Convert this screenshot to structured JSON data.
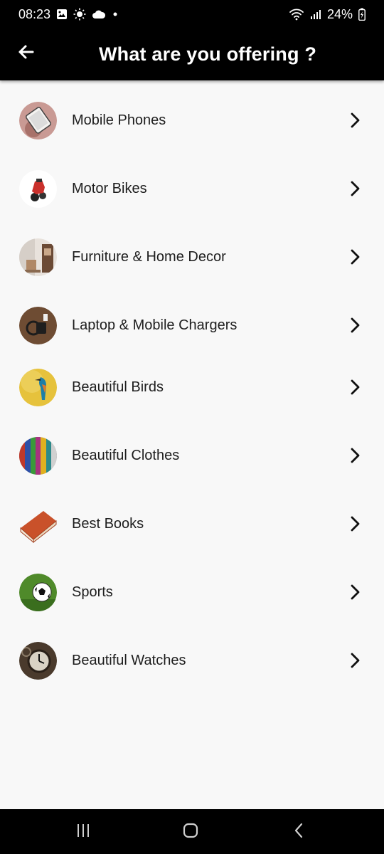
{
  "status_bar": {
    "time": "08:23",
    "battery": "24%"
  },
  "app_bar": {
    "title": "What are you offering ?"
  },
  "categories": [
    {
      "label": "Mobile Phones",
      "icon": "mobile-phone-icon"
    },
    {
      "label": "Motor Bikes",
      "icon": "motor-bike-icon"
    },
    {
      "label": "Furniture & Home Decor",
      "icon": "furniture-icon"
    },
    {
      "label": "Laptop & Mobile Chargers",
      "icon": "charger-icon"
    },
    {
      "label": "Beautiful Birds",
      "icon": "bird-icon"
    },
    {
      "label": "Beautiful Clothes",
      "icon": "clothes-icon"
    },
    {
      "label": "Best Books",
      "icon": "book-icon"
    },
    {
      "label": "Sports",
      "icon": "soccer-ball-icon"
    },
    {
      "label": "Beautiful Watches",
      "icon": "watch-icon"
    }
  ],
  "colors": {
    "bar_background": "#000000",
    "page_background": "#f8f8f8",
    "text": "#1d1d1d"
  }
}
